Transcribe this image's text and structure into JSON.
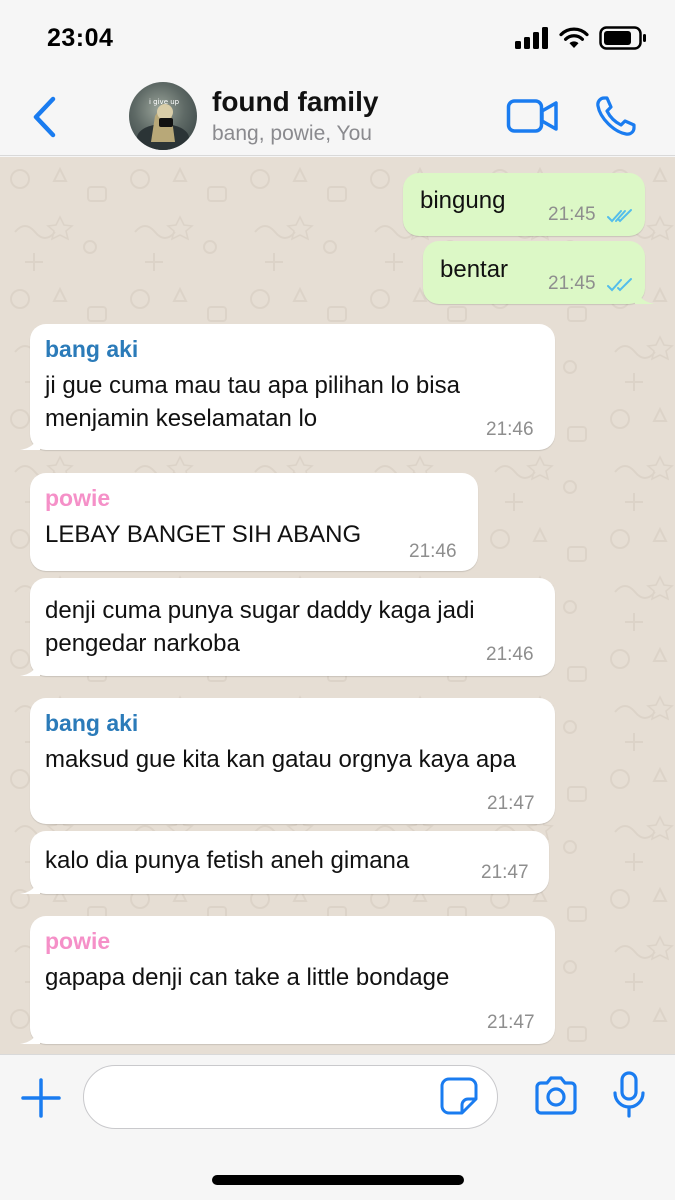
{
  "status_bar": {
    "time": "23:04"
  },
  "header": {
    "title": "found family",
    "subtitle": "bang, powie, You",
    "avatar_text": "i give up"
  },
  "colors": {
    "accent": "#1a7cf0",
    "outgoing_bubble": "#dcf8c6",
    "incoming_bubble": "#ffffff",
    "chat_background": "#e6ded4",
    "sender_bang_aki": "#2b7bb9",
    "sender_powie": "#f590c8",
    "read_ticks": "#53bdeb"
  },
  "icons": {
    "back": "chevron-left-icon",
    "video": "video-camera-icon",
    "call": "phone-icon",
    "attach": "plus-icon",
    "sticker": "sticker-icon",
    "camera": "camera-icon",
    "mic": "microphone-icon"
  },
  "messages": [
    {
      "direction": "out",
      "text": "bingung",
      "time": "21:45",
      "status": "read"
    },
    {
      "direction": "out",
      "text": "bentar",
      "time": "21:45",
      "status": "read"
    },
    {
      "direction": "in",
      "sender": "bang aki",
      "text": "ji gue cuma mau tau apa pilihan lo bisa menjamin keselamatan lo",
      "time": "21:46"
    },
    {
      "direction": "in",
      "sender": "powie",
      "text": "LEBAY BANGET SIH ABANG",
      "time": "21:46"
    },
    {
      "direction": "in",
      "text": "denji cuma punya sugar daddy kaga jadi pengedar narkoba",
      "time": "21:46"
    },
    {
      "direction": "in",
      "sender": "bang aki",
      "text": "maksud gue kita kan gatau orgnya kaya apa",
      "time": "21:47"
    },
    {
      "direction": "in",
      "text": "kalo dia punya fetish aneh gimana",
      "time": "21:47"
    },
    {
      "direction": "in",
      "sender": "powie",
      "text": "gapapa denji can take a little bondage",
      "time": "21:47"
    }
  ],
  "composer": {
    "value": "",
    "placeholder": ""
  }
}
